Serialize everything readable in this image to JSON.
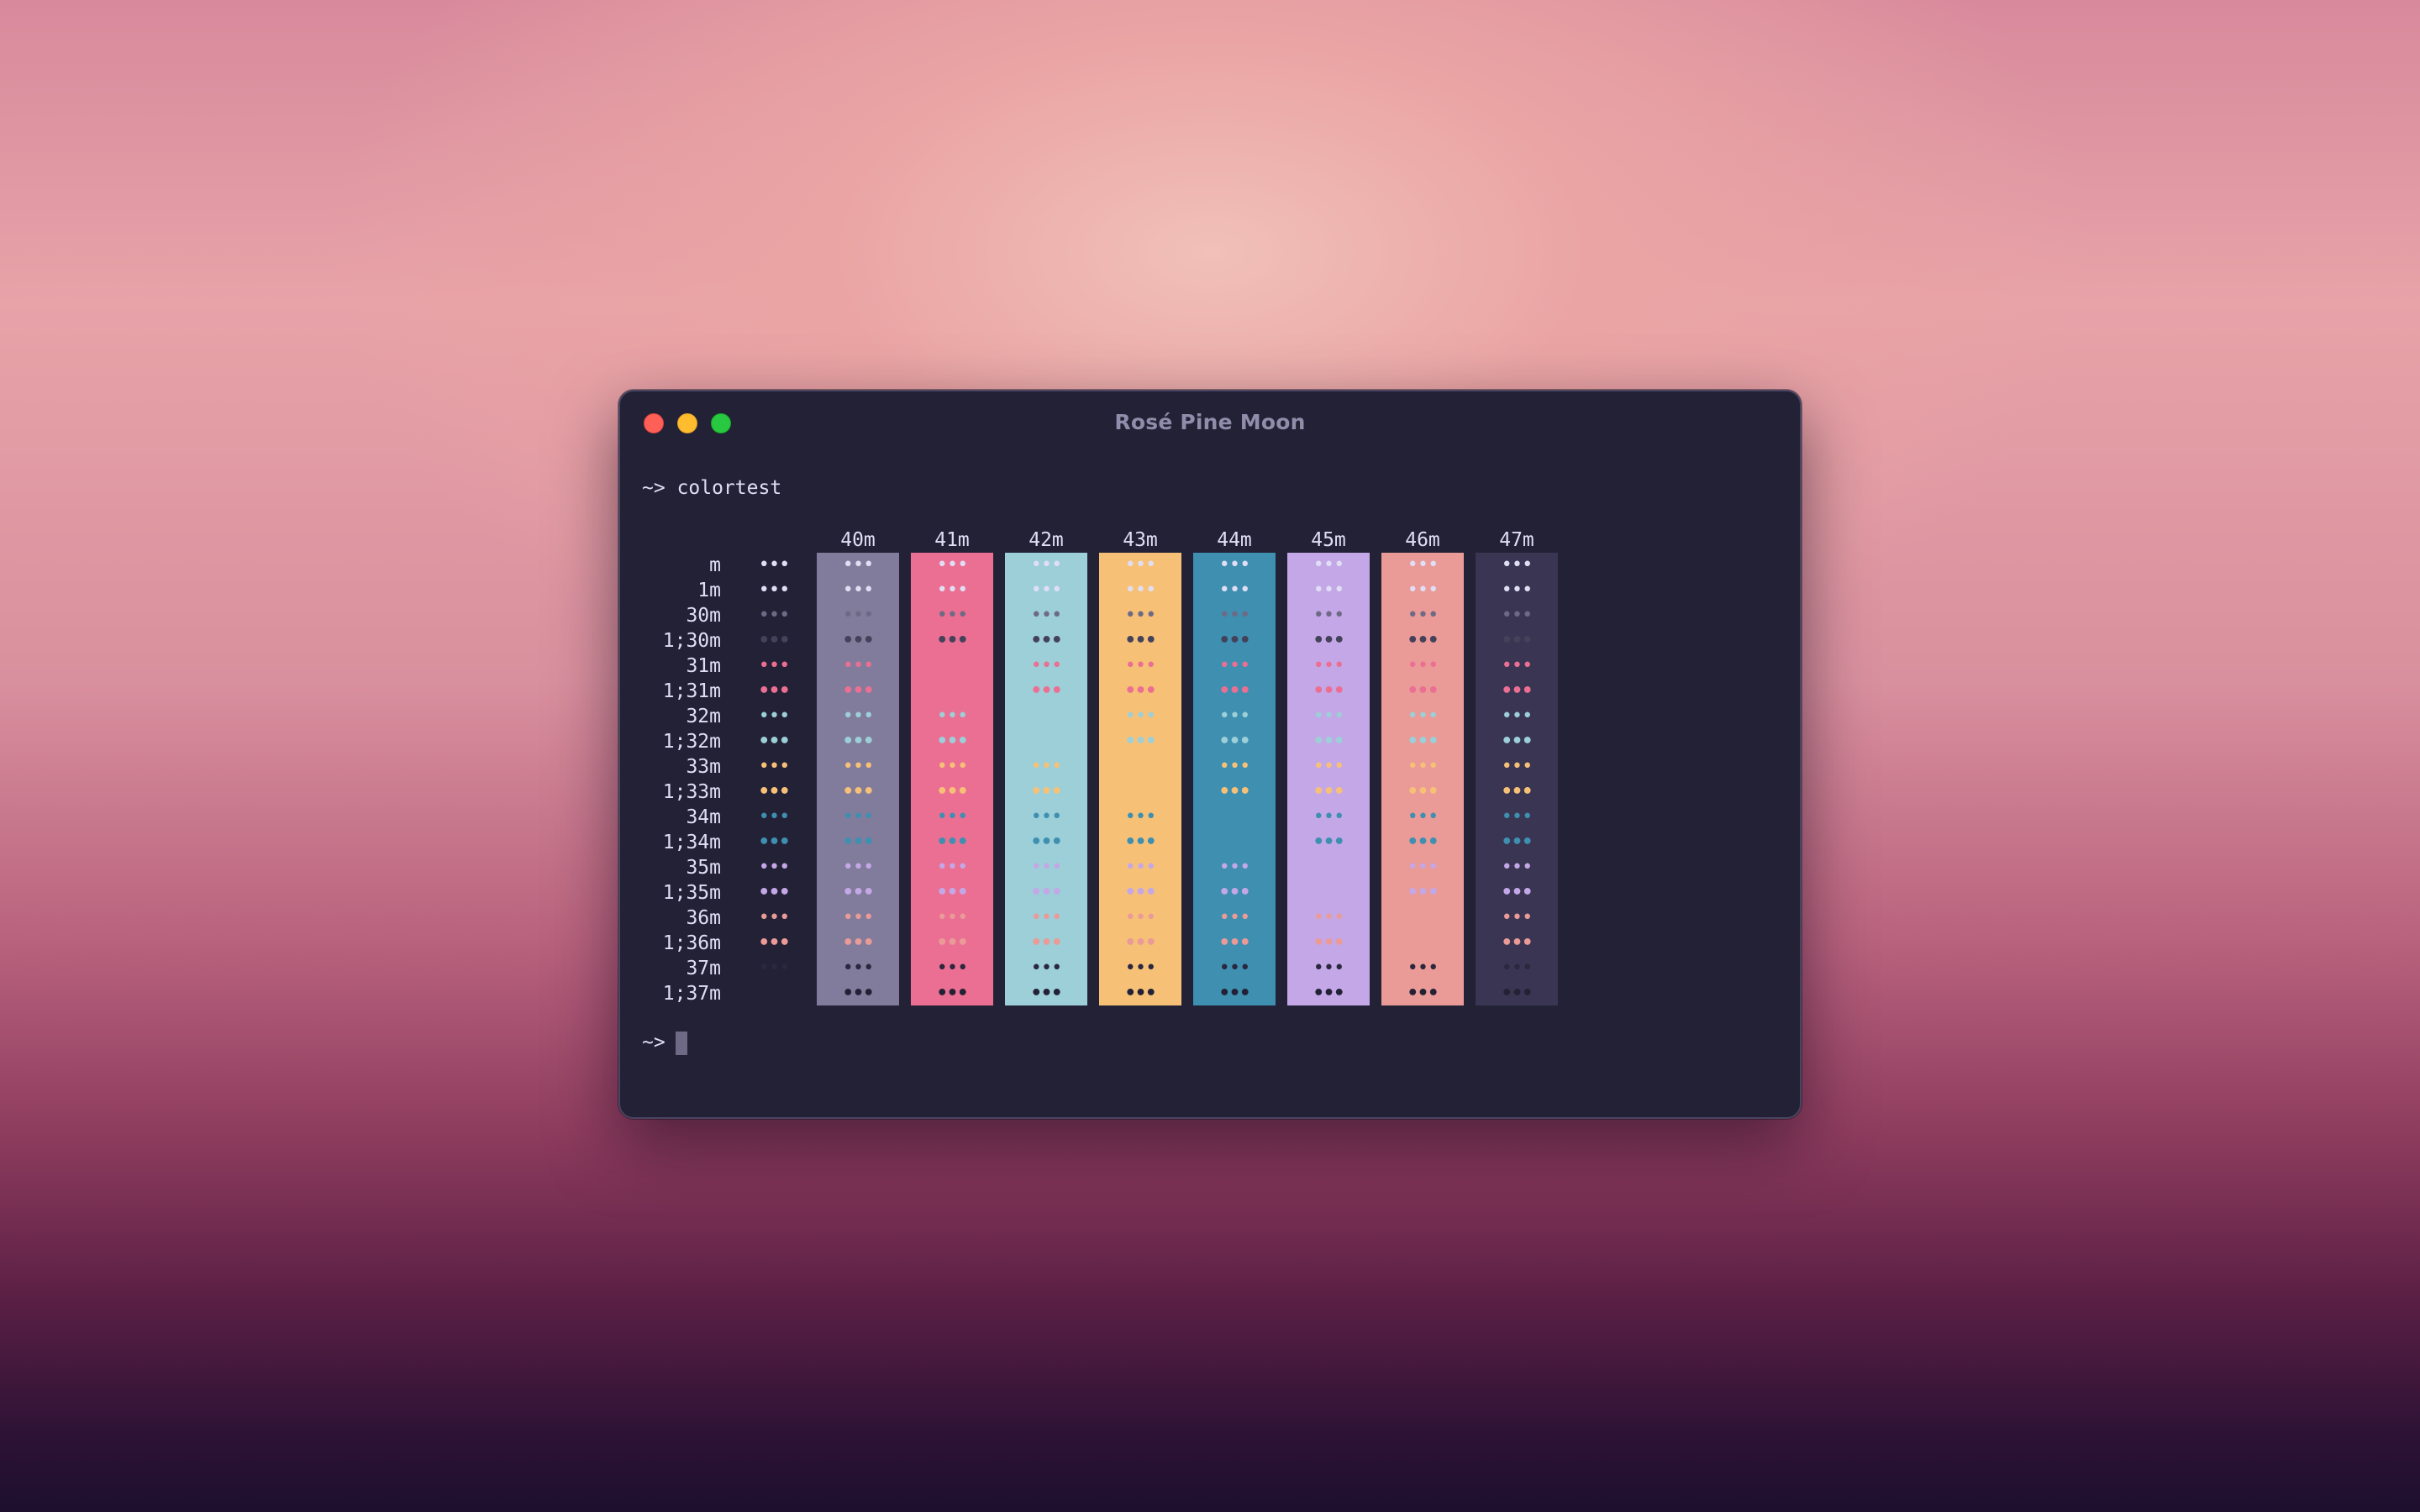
{
  "window": {
    "title": "Rosé Pine Moon",
    "background": "#232136",
    "foreground": "#e0def4"
  },
  "terminal": {
    "prompt": "~>",
    "command": "colortest",
    "cursor_color": "#6e6a86"
  },
  "colortest": {
    "sample": "•••",
    "columns": [
      {
        "label": "",
        "bg": null
      },
      {
        "label": "40m",
        "bg": "#817c9c"
      },
      {
        "label": "41m",
        "bg": "#eb6f92"
      },
      {
        "label": "42m",
        "bg": "#9ccfd8"
      },
      {
        "label": "43m",
        "bg": "#f6c177"
      },
      {
        "label": "44m",
        "bg": "#3e8fb0"
      },
      {
        "label": "45m",
        "bg": "#c4a7e7"
      },
      {
        "label": "46m",
        "bg": "#ea9a97"
      },
      {
        "label": "47m",
        "bg": "#393552"
      }
    ],
    "rows": [
      {
        "label": "m",
        "fg": "#e0def4"
      },
      {
        "label": "1m",
        "fg": "#e0def4"
      },
      {
        "label": "30m",
        "fg": "#6e6a86"
      },
      {
        "label": "1;30m",
        "fg": "#44415a"
      },
      {
        "label": "31m",
        "fg": "#eb6f92"
      },
      {
        "label": "1;31m",
        "fg": "#eb6f92"
      },
      {
        "label": "32m",
        "fg": "#9ccfd8"
      },
      {
        "label": "1;32m",
        "fg": "#9ccfd8"
      },
      {
        "label": "33m",
        "fg": "#f6c177"
      },
      {
        "label": "1;33m",
        "fg": "#f6c177"
      },
      {
        "label": "34m",
        "fg": "#3e8fb0"
      },
      {
        "label": "1;34m",
        "fg": "#3e8fb0"
      },
      {
        "label": "35m",
        "fg": "#c4a7e7"
      },
      {
        "label": "1;35m",
        "fg": "#c4a7e7"
      },
      {
        "label": "36m",
        "fg": "#ea9a97"
      },
      {
        "label": "1;36m",
        "fg": "#ea9a97"
      },
      {
        "label": "37m",
        "fg": "#2a273f"
      },
      {
        "label": "1;37m",
        "fg": "#232136"
      }
    ]
  }
}
